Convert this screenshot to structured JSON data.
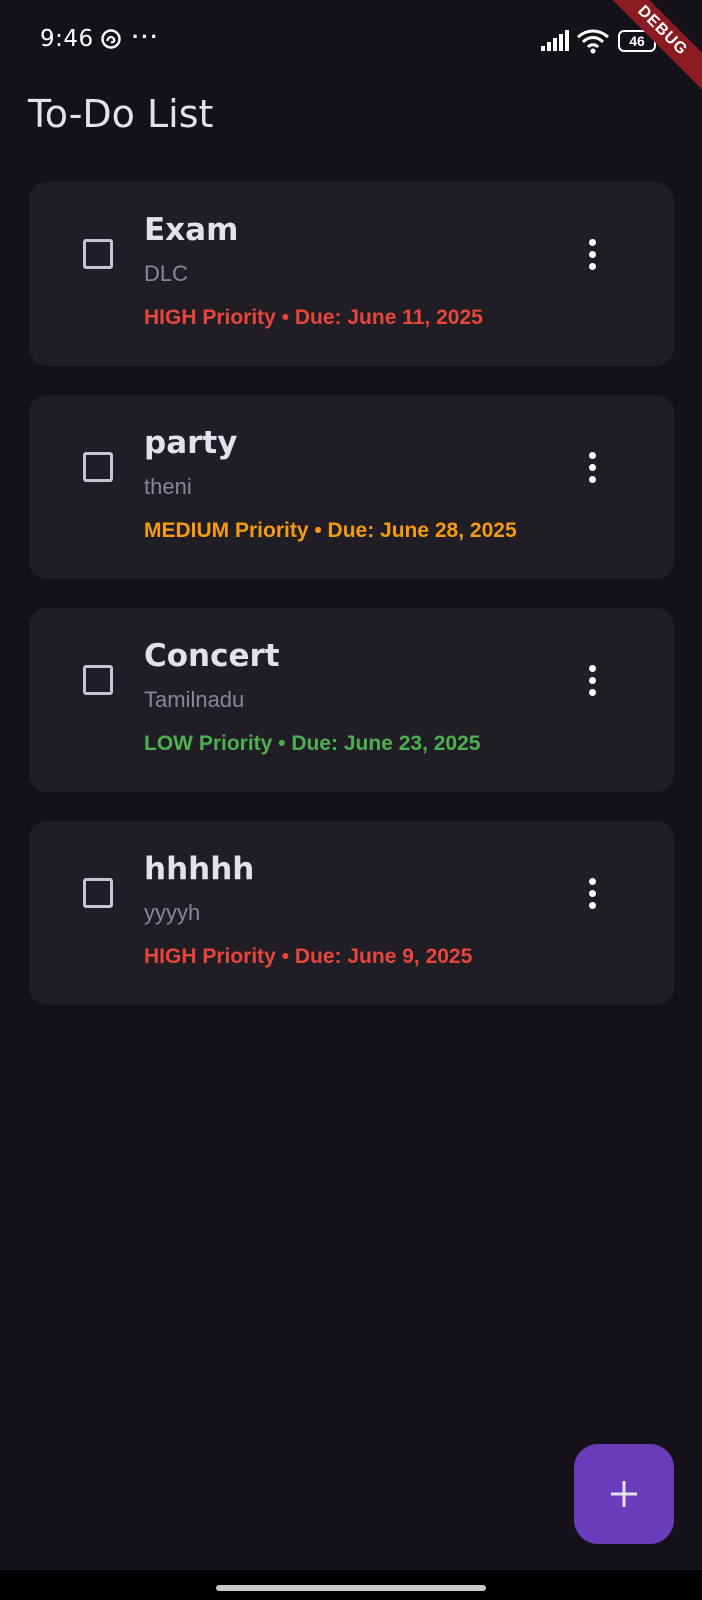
{
  "status_bar": {
    "time": "9:46",
    "more": "···",
    "battery": "46",
    "debug_banner": "DEBUG"
  },
  "app_bar": {
    "title": "To-Do List"
  },
  "tasks": [
    {
      "title": "Exam",
      "subtitle": "DLC",
      "meta": "HIGH Priority • Due: June 11, 2025",
      "priority_color": "#e8453c"
    },
    {
      "title": "party",
      "subtitle": "theni",
      "meta": "MEDIUM Priority • Due: June 28, 2025",
      "priority_color": "#f39c12"
    },
    {
      "title": "Concert",
      "subtitle": "Tamilnadu",
      "meta": "LOW Priority • Due: June 23, 2025",
      "priority_color": "#4caf50"
    },
    {
      "title": "hhhhh",
      "subtitle": "yyyyh",
      "meta": "HIGH Priority • Due: June 9, 2025",
      "priority_color": "#e8453c"
    }
  ],
  "colors": {
    "background": "#141218",
    "card": "#201e24",
    "fab": "#6a3cbc"
  },
  "fab": {
    "icon": "plus-icon"
  }
}
